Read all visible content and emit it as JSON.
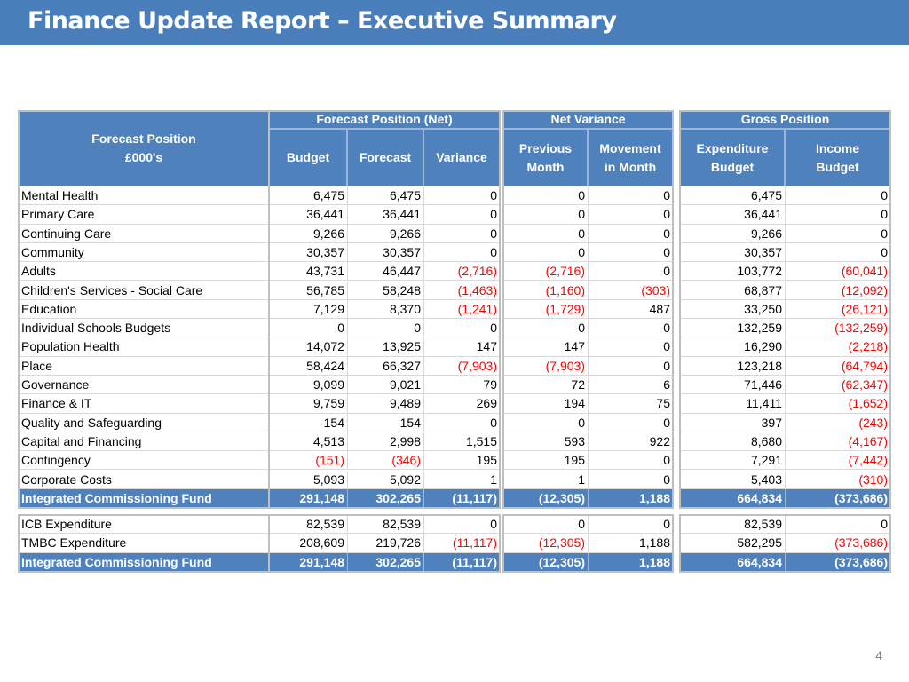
{
  "title": "Finance Update Report – Executive Summary",
  "page_number": "4",
  "colors": {
    "header_blue": "#4f81bd",
    "title_bar": "#4a7ebb",
    "negative_red": "#ff0000"
  },
  "headers": {
    "row_label": [
      "Forecast Position",
      "£000's"
    ],
    "forecast_group": "Forecast Position (Net)",
    "net_variance_group": "Net Variance",
    "gross_group": "Gross Position",
    "budget": "Budget",
    "forecast": "Forecast",
    "variance": "Variance",
    "previous_month": "Previous Month",
    "movement": "Movement in Month",
    "expenditure_budget": "Expenditure Budget",
    "income_budget": "Income Budget"
  },
  "table1": {
    "rows": [
      [
        "Mental Health",
        "6,475",
        "6,475",
        "0",
        "0",
        "0",
        "6,475",
        "0"
      ],
      [
        "Primary Care",
        "36,441",
        "36,441",
        "0",
        "0",
        "0",
        "36,441",
        "0"
      ],
      [
        "Continuing Care",
        "9,266",
        "9,266",
        "0",
        "0",
        "0",
        "9,266",
        "0"
      ],
      [
        "Community",
        "30,357",
        "30,357",
        "0",
        "0",
        "0",
        "30,357",
        "0"
      ],
      [
        "Adults",
        "43,731",
        "46,447",
        "(2,716)",
        "(2,716)",
        "0",
        "103,772",
        "(60,041)"
      ],
      [
        "Children's Services - Social Care",
        "56,785",
        "58,248",
        "(1,463)",
        "(1,160)",
        "(303)",
        "68,877",
        "(12,092)"
      ],
      [
        "Education",
        "7,129",
        "8,370",
        "(1,241)",
        "(1,729)",
        "487",
        "33,250",
        "(26,121)"
      ],
      [
        "Individual Schools Budgets",
        "0",
        "0",
        "0",
        "0",
        "0",
        "132,259",
        "(132,259)"
      ],
      [
        "Population Health",
        "14,072",
        "13,925",
        "147",
        "147",
        "0",
        "16,290",
        "(2,218)"
      ],
      [
        "Place",
        "58,424",
        "66,327",
        "(7,903)",
        "(7,903)",
        "0",
        "123,218",
        "(64,794)"
      ],
      [
        "Governance",
        "9,099",
        "9,021",
        "79",
        "72",
        "6",
        "71,446",
        "(62,347)"
      ],
      [
        "Finance & IT",
        "9,759",
        "9,489",
        "269",
        "194",
        "75",
        "11,411",
        "(1,652)"
      ],
      [
        "Quality and Safeguarding",
        "154",
        "154",
        "0",
        "0",
        "0",
        "397",
        "(243)"
      ],
      [
        "Capital and Financing",
        "4,513",
        "2,998",
        "1,515",
        "593",
        "922",
        "8,680",
        "(4,167)"
      ],
      [
        "Contingency",
        "(151)",
        "(346)",
        "195",
        "195",
        "0",
        "7,291",
        "(7,442)"
      ],
      [
        "Corporate Costs",
        "5,093",
        "5,092",
        "1",
        "1",
        "0",
        "5,403",
        "(310)"
      ]
    ],
    "total": [
      "Integrated Commissioning Fund",
      "291,148",
      "302,265",
      "(11,117)",
      "(12,305)",
      "1,188",
      "664,834",
      "(373,686)"
    ]
  },
  "table2": {
    "rows": [
      [
        "ICB Expenditure",
        "82,539",
        "82,539",
        "0",
        "0",
        "0",
        "82,539",
        "0"
      ],
      [
        "TMBC Expenditure",
        "208,609",
        "219,726",
        "(11,117)",
        "(12,305)",
        "1,188",
        "582,295",
        "(373,686)"
      ]
    ],
    "total": [
      "Integrated Commissioning Fund",
      "291,148",
      "302,265",
      "(11,117)",
      "(12,305)",
      "1,188",
      "664,834",
      "(373,686)"
    ]
  }
}
